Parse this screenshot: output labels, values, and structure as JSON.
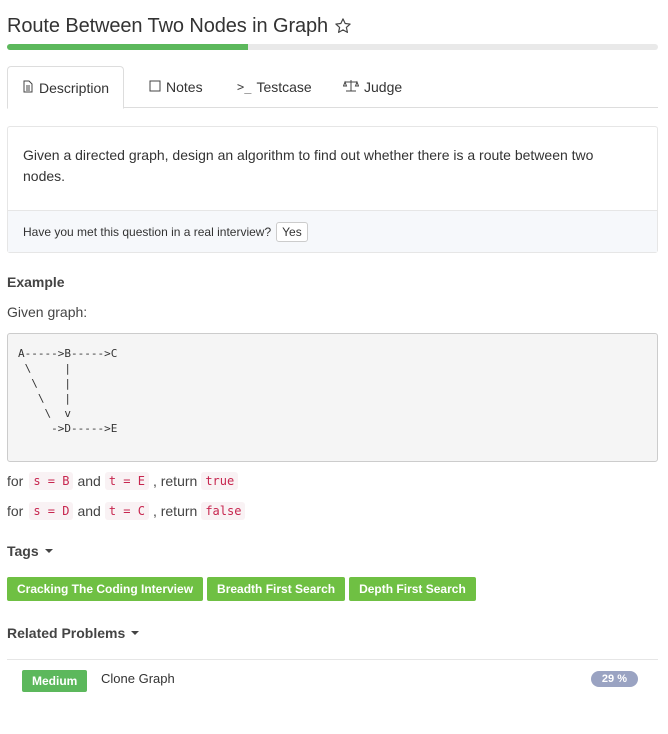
{
  "problem": {
    "title": "Route Between Two Nodes in Graph",
    "progress_fraction": 0.37
  },
  "tabs": [
    {
      "label": "Description",
      "icon": "document-icon"
    },
    {
      "label": "Notes",
      "icon": "note-icon"
    },
    {
      "label": "Testcase",
      "icon": "terminal-icon"
    },
    {
      "label": "Judge",
      "icon": "balance-scale-icon"
    }
  ],
  "description": {
    "text": "Given a directed graph, design an algorithm to find out whether there is a route between two nodes.",
    "interview_question": "Have you met this question in a real interview?",
    "yes_label": "Yes"
  },
  "example": {
    "heading": "Example",
    "given": "Given graph:",
    "graph_ascii": "A----->B----->C\n \\     |\n  \\    |\n   \\   |\n    \\  v\n     ->D----->E",
    "cases": [
      {
        "for": "for",
        "s": "s = B",
        "and": "and",
        "t": "t = E",
        "return_text": ", return",
        "result": "true"
      },
      {
        "for": "for",
        "s": "s = D",
        "and": "and",
        "t": "t = C",
        "return_text": ", return",
        "result": "false"
      }
    ]
  },
  "tags": {
    "heading": "Tags",
    "items": [
      "Cracking The Coding Interview",
      "Breadth First Search",
      "Depth First Search"
    ]
  },
  "related": {
    "heading": "Related Problems",
    "items": [
      {
        "difficulty": "Medium",
        "title": "Clone Graph",
        "rate": "29 %"
      }
    ]
  },
  "colors": {
    "accent_green": "#5cb85c",
    "tag_green": "#6fc043",
    "code_red": "#c7254e",
    "rate_badge": "#9aa3c2"
  }
}
